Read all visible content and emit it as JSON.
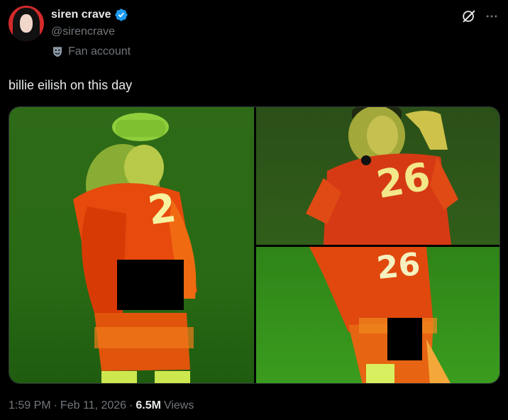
{
  "user": {
    "display_name": "siren crave",
    "handle": "@sirencrave",
    "label": "Fan account"
  },
  "tweet": {
    "text": "billie eilish on this day"
  },
  "media": {
    "photos": [
      {
        "jersey_number": "2"
      },
      {
        "jersey_number": "26"
      },
      {
        "jersey_number": "26"
      }
    ]
  },
  "meta": {
    "time": "1:59 PM",
    "date": "Feb 11, 2026",
    "sep1": "·",
    "sep2": "·",
    "views_count": "6.5M",
    "views_label": "Views"
  },
  "colors": {
    "background": "#000000",
    "text_primary": "#e7e9ea",
    "text_secondary": "#71767b",
    "verified": "#1d9bf0",
    "avatar_bg": "#d32a2a"
  },
  "icons": [
    "verified-badge-icon",
    "fan-account-icon",
    "grok-icon",
    "more-icon"
  ]
}
